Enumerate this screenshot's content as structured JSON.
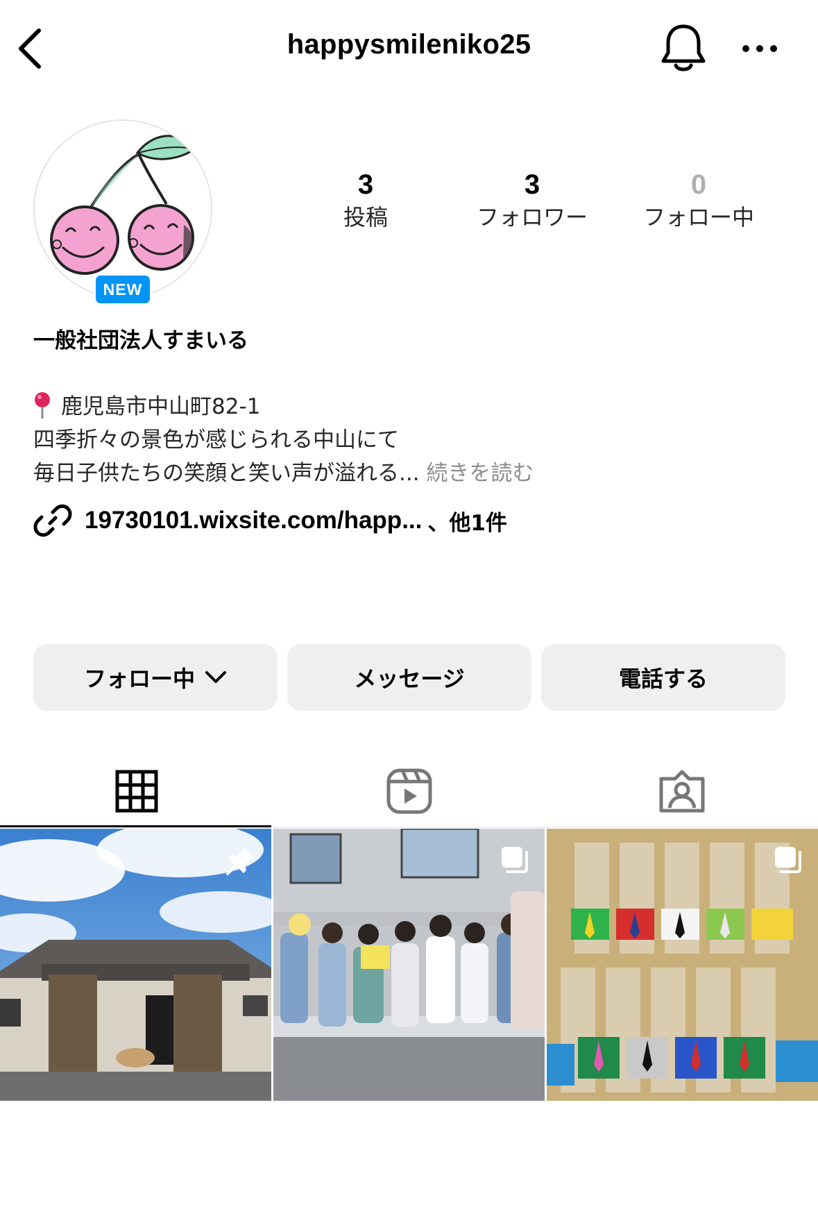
{
  "header": {
    "username": "happysmileniko25",
    "back_icon": "chevron-left-icon",
    "bell_icon": "bell-icon",
    "more_icon": "more-horizontal-icon"
  },
  "profile": {
    "new_badge": "NEW",
    "stats": [
      {
        "value": "3",
        "label": "投稿"
      },
      {
        "value": "3",
        "label": "フォロワー"
      },
      {
        "value": "0",
        "label": "フォロー中"
      }
    ],
    "display_name": "一般社団法人すまいる",
    "bio": {
      "line1": "鹿児島市中山町82-1",
      "line2": "四季折々の景色が感じられる中山にて",
      "line3": "毎日子供たちの笑顔と笑い声が溢れる...",
      "more": "続きを読む"
    },
    "link": {
      "text": "19730101.wixsite.com/happ...",
      "suffix": "、他1件"
    }
  },
  "actions": {
    "following": "フォロー中",
    "message": "メッセージ",
    "call": "電話する"
  },
  "tabs": [
    "posts-grid",
    "reels",
    "tagged"
  ],
  "colors": {
    "accent": "#0095f6",
    "button_bg": "#efefef",
    "muted_text": "#8e8e8e"
  }
}
